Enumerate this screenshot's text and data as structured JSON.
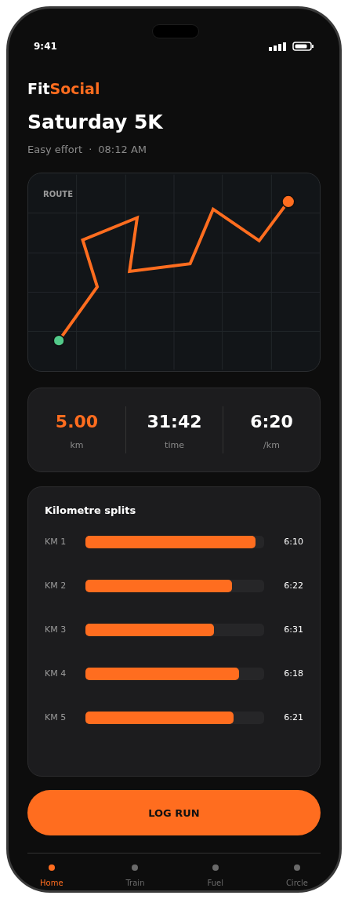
{
  "status_bar": {
    "time": "9:41"
  },
  "brand": {
    "first": "Fit",
    "second": "Social"
  },
  "title": "Saturday 5K",
  "subtitle": {
    "effort": "Easy effort",
    "separator": "·",
    "time": "08:12 AM"
  },
  "route": {
    "label": "ROUTE"
  },
  "stats": [
    {
      "value": "5.00",
      "unit": "km",
      "highlight": true
    },
    {
      "value": "31:42",
      "unit": "time",
      "highlight": false
    },
    {
      "value": "6:20",
      "unit": "/km",
      "highlight": false
    }
  ],
  "splits": {
    "title": "Kilometre splits",
    "rows": [
      {
        "label": "KM 1",
        "level": 0.95,
        "pace": "6:10"
      },
      {
        "label": "KM 2",
        "level": 0.82,
        "pace": "6:22"
      },
      {
        "label": "KM 3",
        "level": 0.72,
        "pace": "6:31"
      },
      {
        "label": "KM 4",
        "level": 0.86,
        "pace": "6:18"
      },
      {
        "label": "KM 5",
        "level": 0.83,
        "pace": "6:21"
      }
    ]
  },
  "action": {
    "label": "LOG RUN"
  },
  "nav": [
    {
      "label": "Home",
      "selected": true
    },
    {
      "label": "Train",
      "selected": false
    },
    {
      "label": "Fuel",
      "selected": false
    },
    {
      "label": "Circle",
      "selected": false
    }
  ]
}
